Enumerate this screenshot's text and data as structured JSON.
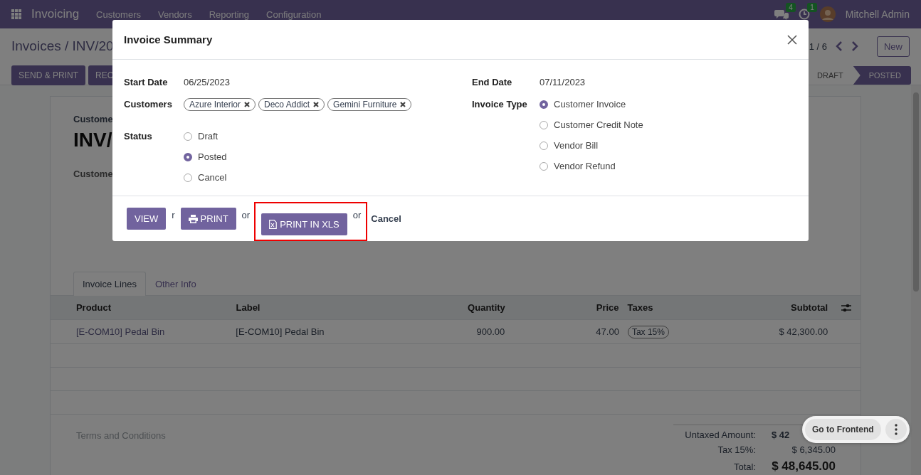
{
  "navbar": {
    "app": "Invoicing",
    "menu": [
      "Customers",
      "Vendors",
      "Reporting",
      "Configuration"
    ],
    "messages_badge": "4",
    "activities_badge": "1",
    "user": "Mitchell Admin"
  },
  "control_panel": {
    "breadcrumb": "Invoices / INV/20",
    "pager": "1 / 6",
    "new_button": "New",
    "buttons": [
      "SEND & PRINT",
      "REC"
    ],
    "status": [
      {
        "label": "DRAFT",
        "selected": false
      },
      {
        "label": "POSTED",
        "selected": true
      }
    ]
  },
  "sheet": {
    "partner_label": "Custome",
    "title": "INV/",
    "field_label": "Custome",
    "tabs": [
      {
        "label": "Invoice Lines",
        "selected": true
      },
      {
        "label": "Other Info",
        "selected": false
      }
    ],
    "table": {
      "columns": [
        "Product",
        "Label",
        "Quantity",
        "Price",
        "Taxes",
        "Subtotal"
      ],
      "rows": [
        {
          "product": "[E-COM10] Pedal Bin",
          "label": "[E-COM10] Pedal Bin",
          "quantity": "900.00",
          "price": "47.00",
          "taxes": [
            "Tax 15%"
          ],
          "subtotal": "$ 42,300.00"
        }
      ]
    },
    "terms_placeholder": "Terms and Conditions",
    "totals": [
      {
        "label": "Untaxed Amount:",
        "value": "$ 42",
        "kind": "bold"
      },
      {
        "label": "Tax 15%:",
        "value": "$ 6,345.00",
        "kind": "plain"
      },
      {
        "label": "Total:",
        "value": "$ 48,645.00",
        "kind": "grand"
      }
    ]
  },
  "floating_button": {
    "label": "Go to Frontend"
  },
  "dialog": {
    "title": "Invoice Summary",
    "start_date_label": "Start Date",
    "start_date": "06/25/2023",
    "end_date_label": "End Date",
    "end_date": "07/11/2023",
    "customers_label": "Customers",
    "customers": [
      "Azure Interior",
      "Deco Addict",
      "Gemini Furniture"
    ],
    "status_label": "Status",
    "status_options": [
      {
        "label": "Draft",
        "selected": false
      },
      {
        "label": "Posted",
        "selected": true
      },
      {
        "label": "Cancel",
        "selected": false
      }
    ],
    "invoice_type_label": "Invoice Type",
    "invoice_types": [
      {
        "label": "Customer Invoice",
        "selected": true
      },
      {
        "label": "Customer Credit Note",
        "selected": false
      },
      {
        "label": "Vendor Bill",
        "selected": false
      },
      {
        "label": "Vendor Refund",
        "selected": false
      }
    ],
    "footer": [
      {
        "kind": "button",
        "label": "VIEW",
        "highlighted": false
      },
      {
        "kind": "separator",
        "label": "r"
      },
      {
        "kind": "print",
        "label": "PRINT",
        "highlighted": false
      },
      {
        "kind": "separator",
        "label": "or"
      },
      {
        "kind": "xls",
        "label": "PRINT IN XLS",
        "highlighted": true
      },
      {
        "kind": "separator",
        "label": "or"
      },
      {
        "kind": "link",
        "label": "Cancel"
      }
    ]
  }
}
